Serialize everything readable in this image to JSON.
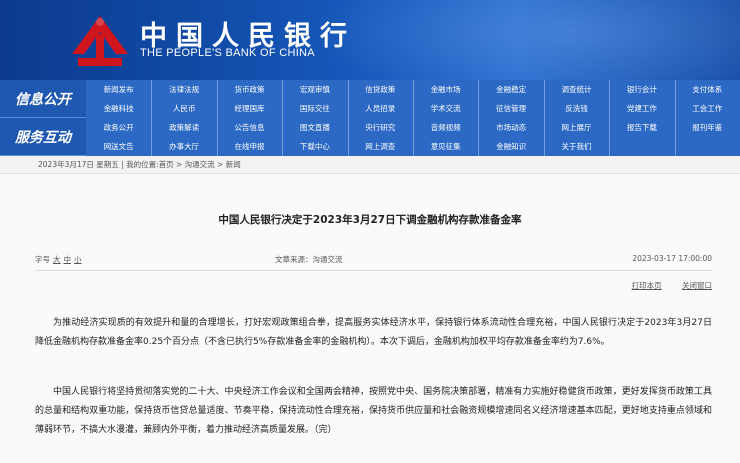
{
  "header": {
    "logo_cn": "中国人民银行",
    "logo_en": "THE PEOPLE'S BANK OF CHINA"
  },
  "nav": {
    "section_top": "信息公开",
    "section_bottom": "服务互动",
    "rows": [
      [
        "新闻发布",
        "法律法规",
        "货币政策",
        "宏观审慎",
        "信贷政策",
        "金融市场",
        "金融稳定",
        "调查统计",
        "银行会计",
        "支付体系"
      ],
      [
        "金融科技",
        "人民币",
        "经理国库",
        "国际交往",
        "人员招录",
        "学术交流",
        "征信管理",
        "反洗钱",
        "党建工作",
        "工会工作"
      ],
      [
        "政务公开",
        "政策解读",
        "公告信息",
        "图文直播",
        "央行研究",
        "音频视频",
        "市场动态",
        "网上展厅",
        "报告下载",
        "报刊年鉴"
      ],
      [
        "网送文告",
        "办事大厅",
        "在线申报",
        "下载中心",
        "网上调查",
        "意见征集",
        "金融知识",
        "关于我们",
        "",
        ""
      ]
    ]
  },
  "breadcrumb": "2023年3月17日 星期五 | 我的位置:首页 > 沟通交流 > 新闻",
  "article": {
    "title": "中国人民银行决定于2023年3月27日下调金融机构存款准备金率",
    "font_size_label": "字号",
    "size_large": "大",
    "size_medium": "中",
    "size_small": "小",
    "source": "文章来源：沟通交流",
    "date": "2023-03-17 17:00:00",
    "print_label": "打印本页",
    "close_label": "关闭窗口",
    "paragraph1": "为推动经济实现质的有效提升和量的合理增长，打好宏观政策组合拳，提高服务实体经济水平，保持银行体系流动性合理充裕，中国人民银行决定于2023年3月27日降低金融机构存款准备金率0.25个百分点（不含已执行5%存款准备金率的金融机构）。本次下调后，金融机构加权平均存款准备金率约为7.6%。",
    "paragraph2": "中国人民银行将坚持贯彻落实党的二十大、中央经济工作会议和全国两会精神，按照党中央、国务院决策部署，精准有力实施好稳健货币政策，更好发挥货币政策工具的总量和结构双重功能，保持货币信贷总量适度、节奏平稳，保持流动性合理充裕，保持货币供应量和社会融资规模增速同名义经济增速基本匹配，更好地支持重点领域和薄弱环节，不搞大水漫灌，兼顾内外平衡，着力推动经济高质量发展。（完）"
  },
  "colors": {
    "banner": "#1556b8",
    "nav": "#2b69c4",
    "logo_red": "#d0151c"
  }
}
